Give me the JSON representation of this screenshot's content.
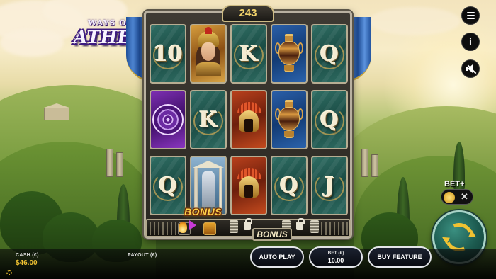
{
  "game": {
    "logo_ways": "WAYS OF",
    "logo_athena": "ATHENA",
    "ways_count": "243"
  },
  "reels": [
    [
      {
        "symbol": "10",
        "frame": "teal"
      },
      {
        "symbol": "shield",
        "frame": "purple"
      },
      {
        "symbol": "Q",
        "frame": "teal"
      }
    ],
    [
      {
        "symbol": "athena",
        "frame": "gold"
      },
      {
        "symbol": "K",
        "frame": "teal"
      },
      {
        "symbol": "bonus-statue",
        "frame": "stone"
      }
    ],
    [
      {
        "symbol": "K",
        "frame": "teal"
      },
      {
        "symbol": "helmet",
        "frame": "red"
      },
      {
        "symbol": "helmet",
        "frame": "red"
      }
    ],
    [
      {
        "symbol": "amphora",
        "frame": "blue"
      },
      {
        "symbol": "amphora",
        "frame": "blue"
      },
      {
        "symbol": "Q",
        "frame": "teal"
      }
    ],
    [
      {
        "symbol": "Q",
        "frame": "teal"
      },
      {
        "symbol": "Q",
        "frame": "teal"
      },
      {
        "symbol": "J",
        "frame": "teal"
      }
    ]
  ],
  "bonus_symbol_label": "BONUS",
  "meter": {
    "label": "BONUS"
  },
  "side_controls": {
    "menu_icon": "menu-icon",
    "info_label": "i",
    "sound_icon": "mute-icon",
    "bet_plus_label": "BET+",
    "bet_plus_toggle_symbol": "✕"
  },
  "bottom_bar": {
    "cash_label": "CASH (€)",
    "cash_value": "$46.00",
    "payout_label": "PAYOUT (€)",
    "auto_play_label": "AUTO PLAY",
    "bet_label": "BET (€)",
    "bet_value": "10.00",
    "buy_feature_label": "BUY FEATURE"
  },
  "colors": {
    "accent_gold": "#f0c232",
    "spin_teal": "#1c5a4f"
  }
}
